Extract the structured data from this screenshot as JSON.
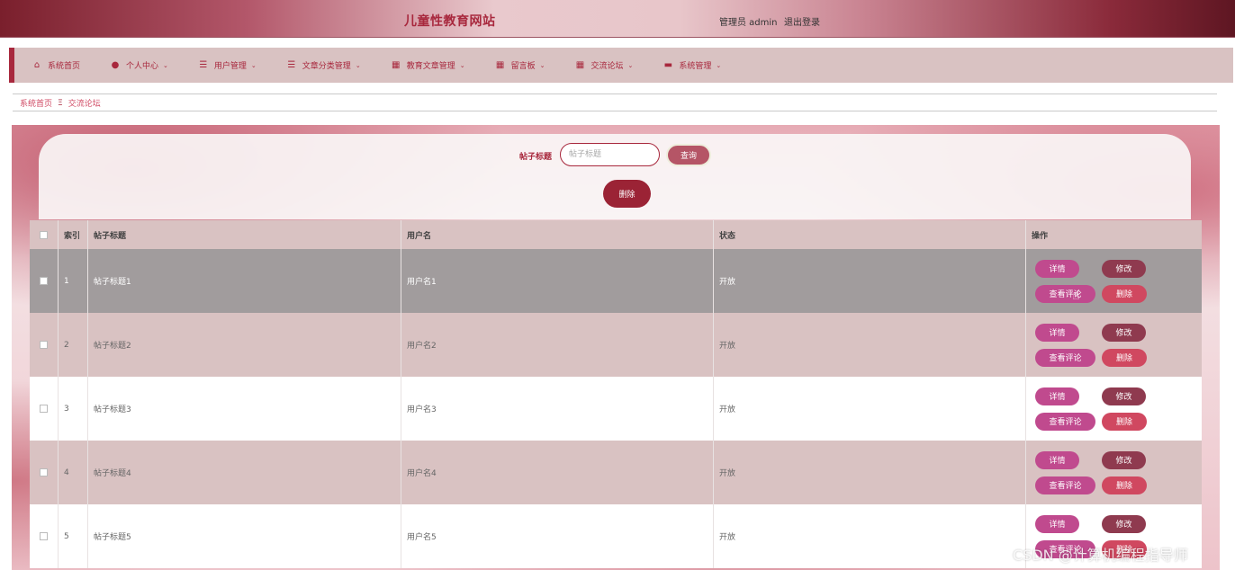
{
  "header": {
    "title": "儿童性教育网站",
    "admin_label": "管理员 admin",
    "logout_label": "退出登录"
  },
  "nav": {
    "items": [
      {
        "label": "系统首页",
        "icon": "home-icon",
        "has_dropdown": false
      },
      {
        "label": "个人中心",
        "icon": "user-icon",
        "has_dropdown": true
      },
      {
        "label": "用户管理",
        "icon": "list-icon",
        "has_dropdown": true
      },
      {
        "label": "文章分类管理",
        "icon": "list-icon",
        "has_dropdown": true
      },
      {
        "label": "教育文章管理",
        "icon": "grid-icon",
        "has_dropdown": true
      },
      {
        "label": "留言板",
        "icon": "grid-icon",
        "has_dropdown": true
      },
      {
        "label": "交流论坛",
        "icon": "grid-icon",
        "has_dropdown": true
      },
      {
        "label": "系统管理",
        "icon": "ticket-icon",
        "has_dropdown": true
      }
    ]
  },
  "breadcrumb": {
    "home": "系统首页",
    "separator": "Ξ",
    "current": "交流论坛"
  },
  "search": {
    "label": "帖子标题",
    "placeholder": "帖子标题",
    "query_button": "查询",
    "delete_button": "删除"
  },
  "table": {
    "headers": {
      "index": "索引",
      "title": "帖子标题",
      "username": "用户名",
      "status": "状态",
      "actions": "操作"
    },
    "action_labels": {
      "detail": "详情",
      "edit": "修改",
      "comments": "查看评论",
      "delete": "删除"
    },
    "rows": [
      {
        "index": "1",
        "title": "帖子标题1",
        "username": "用户名1",
        "status": "开放"
      },
      {
        "index": "2",
        "title": "帖子标题2",
        "username": "用户名2",
        "status": "开放"
      },
      {
        "index": "3",
        "title": "帖子标题3",
        "username": "用户名3",
        "status": "开放"
      },
      {
        "index": "4",
        "title": "帖子标题4",
        "username": "用户名4",
        "status": "开放"
      },
      {
        "index": "5",
        "title": "帖子标题5",
        "username": "用户名5",
        "status": "开放"
      }
    ]
  },
  "watermark": "CSDN @计算机编程指导师",
  "colors": {
    "brand": "#a8283d",
    "nav_bg": "#d9c2c2",
    "detail_btn": "#c04a8e",
    "edit_btn": "#8f3a4f",
    "delete_btn": "#d04860",
    "hover_row": "#a19c9d"
  }
}
